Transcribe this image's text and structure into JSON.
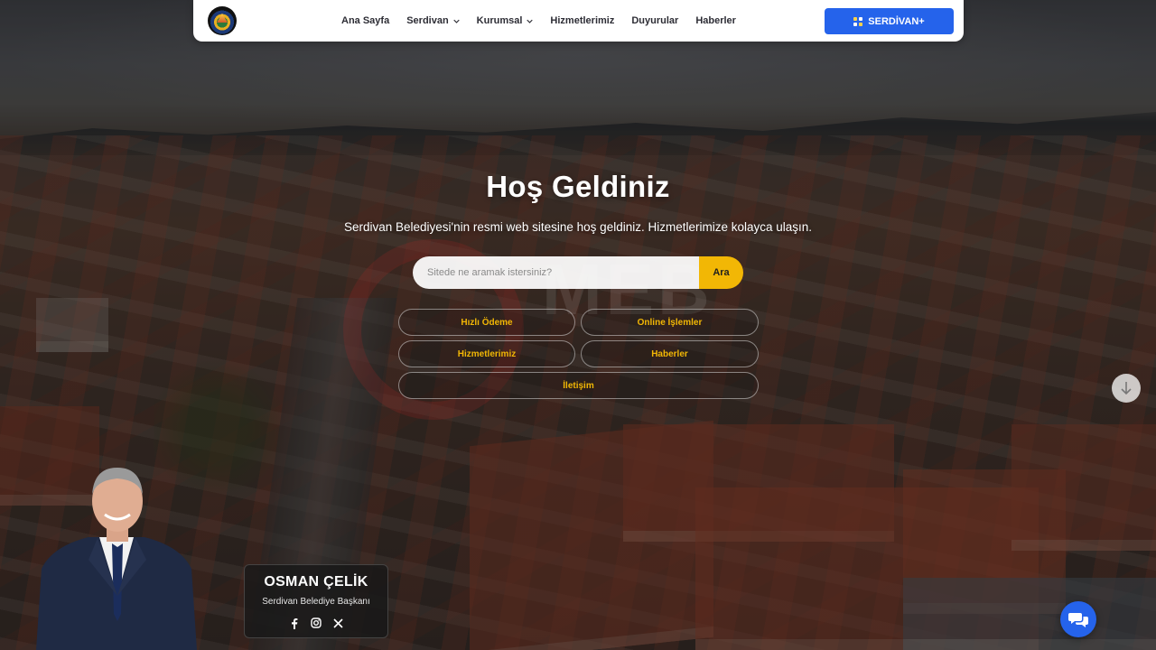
{
  "nav": {
    "logo_alt": "logo",
    "items": [
      {
        "label": "Ana Sayfa",
        "has_dropdown": false
      },
      {
        "label": "Serdivan",
        "has_dropdown": true
      },
      {
        "label": "Kurumsal",
        "has_dropdown": true
      },
      {
        "label": "Hizmetlerimiz",
        "has_dropdown": false
      },
      {
        "label": "Duyurular",
        "has_dropdown": false
      },
      {
        "label": "Haberler",
        "has_dropdown": false
      }
    ],
    "cta_label": "SERDİVAN+",
    "cta_icon": "grid-icon"
  },
  "hero": {
    "title": "Hoş Geldiniz",
    "subtitle": "Serdivan Belediyesi'nin resmi web sitesine hoş geldiniz. Hizmetlerimize kolayca ulaşın.",
    "search_placeholder": "Sitede ne aramak istersiniz?",
    "search_button": "Ara"
  },
  "quick_links": [
    {
      "label": "Hızlı Ödeme"
    },
    {
      "label": "Online İşlemler"
    },
    {
      "label": "Hizmetlerimiz"
    },
    {
      "label": "Haberler"
    },
    {
      "label": "İletişim"
    }
  ],
  "watermark_text": "MEB",
  "mayor": {
    "name": "OSMAN ÇELİK",
    "role": "Serdivan Belediye Başkanı",
    "socials": [
      "facebook-icon",
      "instagram-icon",
      "x-icon"
    ]
  },
  "colors": {
    "accent_blue": "#2563eb",
    "accent_yellow": "#f2b705",
    "nav_text": "#2d2d35"
  },
  "icons": {
    "scroll": "arrow-down-icon",
    "chat": "chat-icon"
  }
}
